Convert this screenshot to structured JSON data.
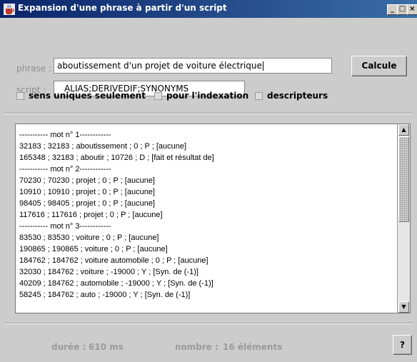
{
  "window": {
    "title": "Expansion d'une phrase à partir d'un script",
    "controls": [
      "_",
      "□",
      "×"
    ]
  },
  "form": {
    "phrase_label": "phrase :",
    "phrase_value": "aboutissement d'un projet de voiture électrique",
    "script_label": "script :",
    "script_value": "ALIAS;DERIVEDIF;SYNONYMS",
    "calc_button": "Calcule"
  },
  "options": [
    {
      "label": "sens uniques seulement",
      "checked": false
    },
    {
      "label": "pour l'indexation",
      "checked": false
    },
    {
      "label": "descripteurs",
      "checked": false
    }
  ],
  "results": [
    "----------- mot n° 1------------",
    "32183 ; 32183 ; aboutissement ; 0 ; P ; [aucune]",
    "165348 ; 32183 ; aboutir ; 10726 ; D ; [fait et résultat de]",
    "----------- mot n° 2------------",
    "70230 ; 70230 ; projet ; 0 ; P ; [aucune]",
    "10910 ; 10910 ; projet ; 0 ; P ; [aucune]",
    "98405 ; 98405 ; projet ; 0 ; P ; [aucune]",
    "117616 ; 117616 ; projet ; 0 ; P ; [aucune]",
    "----------- mot n° 3------------",
    "83530 ; 83530 ; voiture ; 0 ; P ; [aucune]",
    "190865 ; 190865 ; voiture ; 0 ; P ; [aucune]",
    "184762 ; 184762 ; voiture automobile ; 0 ; P ; [aucune]",
    "32030 ; 184762 ; voiture ; -19000 ; Y ; [Syn. de (-1)]",
    "40209 ; 184762 ; automobile ; -19000 ; Y ; [Syn. de (-1)]",
    "58245 ; 184762 ; auto ; -19000 ; Y ; [Syn. de (-1)]"
  ],
  "status": {
    "duree_label": "durée :",
    "duree_value": "610 ms",
    "nombre_label": "nombre :",
    "nombre_value": "16 éléments",
    "help_button": "?"
  },
  "colors": {
    "titlebar_start": "#0a246a",
    "titlebar_end": "#3a6ea5",
    "panel_bg": "#cccccc"
  }
}
